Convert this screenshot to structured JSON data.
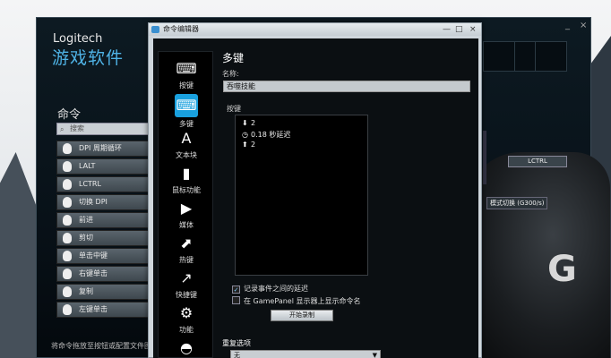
{
  "main": {
    "brand": "Logitech",
    "brand_sub": "游戏软件",
    "commands_title": "命令",
    "search_placeholder": "搜索",
    "commands": [
      "DPI 周期循环",
      "LALT",
      "LCTRL",
      "切换 DPI",
      "前进",
      "剪切",
      "单击中键",
      "右键单击",
      "复制",
      "左键单击"
    ],
    "footer": "将命令拖放至按钮或配置文件图标",
    "lctrl_label": "LCTRL",
    "mode_label": "模式切换 (G300/s)",
    "win_controls": [
      "_",
      "×"
    ]
  },
  "editor": {
    "title": "命令编辑器",
    "win_controls": [
      "—",
      "□",
      "×"
    ],
    "nav": [
      {
        "label": "按键",
        "icon": "keyboard-icon",
        "glyph": "⌨"
      },
      {
        "label": "多键",
        "icon": "multikey-icon",
        "glyph": "⌨"
      },
      {
        "label": "文本块",
        "icon": "text-block-icon",
        "glyph": "A"
      },
      {
        "label": "鼠标功能",
        "icon": "mouse-icon",
        "glyph": "▮"
      },
      {
        "label": "媒体",
        "icon": "play-icon",
        "glyph": "▶"
      },
      {
        "label": "热键",
        "icon": "hotkey-icon",
        "glyph": "⬈"
      },
      {
        "label": "快捷键",
        "icon": "shortcut-icon",
        "glyph": "↗"
      },
      {
        "label": "功能",
        "icon": "gear-icon",
        "glyph": "⚙"
      },
      {
        "label": "",
        "icon": "headset-icon",
        "glyph": "◓"
      }
    ],
    "section_title": "多键",
    "name_label": "名称:",
    "name_value": "吞噬技能",
    "keys_label": "按键",
    "key_rows": [
      {
        "glyph": "⬇",
        "text": "2"
      },
      {
        "glyph": "◷",
        "text": "0.18 秒延迟"
      },
      {
        "glyph": "⬆",
        "text": "2"
      }
    ],
    "record_delays_label": "记录事件之间的延迟",
    "record_delays_checked": true,
    "show_on_gamepanel_label": "在 GamePanel 显示器上显示命令名",
    "show_on_gamepanel_checked": false,
    "start_record_label": "开始录制",
    "repeat_title": "重复选项",
    "repeat_value": "无"
  }
}
